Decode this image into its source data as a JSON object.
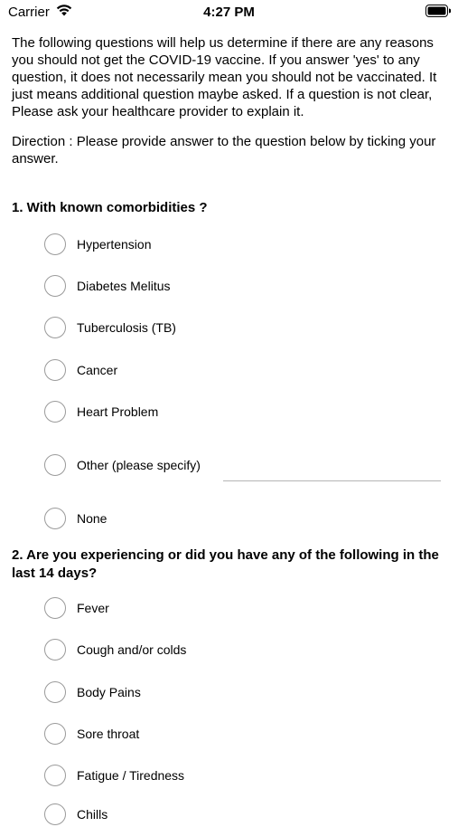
{
  "status": {
    "carrier": "Carrier",
    "time": "4:27 PM"
  },
  "intro": "The following questions will help us determine if there are any reasons you should not get the COVID-19 vaccine. If you answer 'yes' to any question, it does not necessarily mean you should not be vaccinated. It just means additional question maybe asked. If a question is not clear, Please ask your healthcare provider to explain it.",
  "direction": "Direction : Please provide answer to the question below by ticking your answer.",
  "questions": [
    {
      "title": "1. With known comorbidities ?",
      "options": [
        "Hypertension",
        "Diabetes Melitus",
        "Tuberculosis (TB)",
        "Cancer",
        "Heart Problem",
        "Other (please specify)",
        "None"
      ]
    },
    {
      "title": "2. Are you experiencing or did you have any of the following in the last 14 days?",
      "options": [
        "Fever",
        "Cough and/or colds",
        "Body Pains",
        "Sore throat",
        "Fatigue / Tiredness",
        "Chills"
      ]
    }
  ]
}
